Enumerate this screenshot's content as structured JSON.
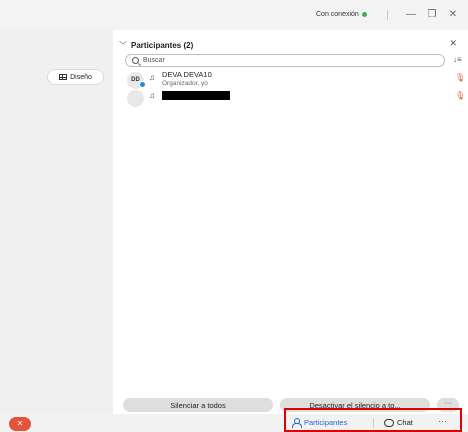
{
  "titlebar": {
    "connection_status": "Con conexión",
    "status_color": "#2db84d",
    "minimize_glyph": "—",
    "restore_glyph": "❐",
    "close_glyph": "✕"
  },
  "left": {
    "layout_button_label": "Diseño"
  },
  "panel": {
    "title": "Participantes (2)",
    "collapse_glyph": "﹀",
    "close_glyph": "✕",
    "search": {
      "placeholder": "Buscar",
      "value": ""
    },
    "participants": [
      {
        "initials": "DD",
        "name": "DEVA DEVA10",
        "role": "Organizador, yo"
      },
      {
        "initials": "",
        "name": "",
        "role": ""
      }
    ],
    "mute_all_label": "Silenciar a todos",
    "unmute_all_label": "Desactivar el silencio a to...",
    "more_glyph": "···"
  },
  "footer": {
    "participants_tab": "Participantes",
    "chat_tab": "Chat",
    "more_glyph": "···",
    "leave_glyph": "✕",
    "accent_color": "#2a67c6",
    "leave_color": "#e5533d"
  }
}
